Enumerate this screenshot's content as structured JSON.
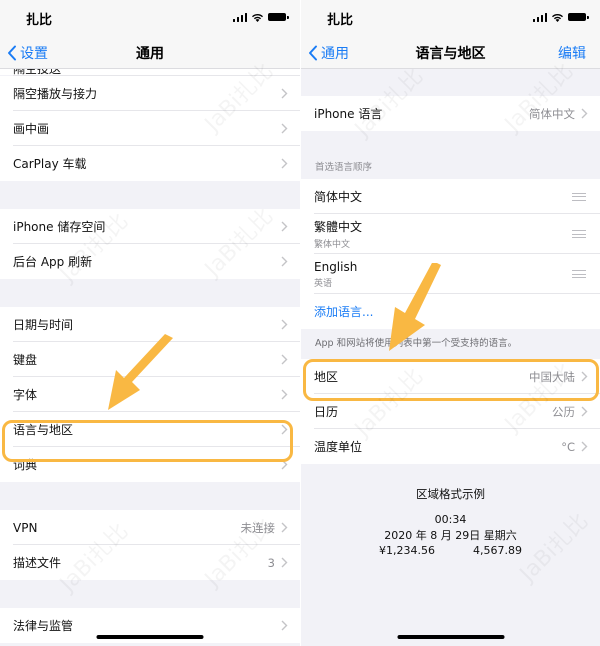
{
  "status_bar": {
    "carrier": "扎比",
    "icons": [
      "cellular-signal-icon",
      "wifi-icon",
      "battery-icon"
    ]
  },
  "left_screen": {
    "nav": {
      "back_label": "设置",
      "title": "通用"
    },
    "partial_item": "隔空投送",
    "groups": [
      {
        "items": [
          {
            "label": "隔空播放与接力",
            "value": ""
          },
          {
            "label": "画中画",
            "value": ""
          },
          {
            "label": "CarPlay 车载",
            "value": ""
          }
        ]
      },
      {
        "items": [
          {
            "label": "iPhone 储存空间",
            "value": ""
          },
          {
            "label": "后台 App 刷新",
            "value": ""
          }
        ]
      },
      {
        "items": [
          {
            "label": "日期与时间",
            "value": ""
          },
          {
            "label": "键盘",
            "value": ""
          },
          {
            "label": "字体",
            "value": ""
          },
          {
            "label": "语言与地区",
            "value": "",
            "highlighted": true
          },
          {
            "label": "词典",
            "value": ""
          }
        ]
      },
      {
        "items": [
          {
            "label": "VPN",
            "value": "未连接"
          },
          {
            "label": "描述文件",
            "value": "3"
          }
        ]
      },
      {
        "items": [
          {
            "label": "法律与监管",
            "value": ""
          }
        ]
      }
    ]
  },
  "right_screen": {
    "nav": {
      "back_label": "通用",
      "title": "语言与地区",
      "action_label": "编辑"
    },
    "iphone_language": {
      "label": "iPhone 语言",
      "value": "简体中文"
    },
    "preferred_header": "首选语言顺序",
    "preferred_languages": [
      {
        "label": "简体中文",
        "sub": ""
      },
      {
        "label": "繁體中文",
        "sub": "繁体中文"
      },
      {
        "label": "English",
        "sub": "英语"
      }
    ],
    "add_language": "添加语言...",
    "preferred_footer": "App 和网站将使用列表中第一个受支持的语言。",
    "region_items": [
      {
        "label": "地区",
        "value": "中国大陆",
        "highlighted": true
      },
      {
        "label": "日历",
        "value": "公历"
      },
      {
        "label": "温度单位",
        "value": "°C"
      }
    ],
    "format_example": {
      "title": "区域格式示例",
      "time": "00:34",
      "date": "2020 年 8 月 29日 星期六",
      "currency": "¥1,234.56",
      "number": "4,567.89"
    }
  },
  "annotations": {
    "highlight_color": "#f9b843",
    "watermark_text": "JaBi扎比"
  },
  "colors": {
    "accent": "#1a7cf5",
    "background": "#f2f2f7",
    "secondary_text": "#8e8e93"
  }
}
